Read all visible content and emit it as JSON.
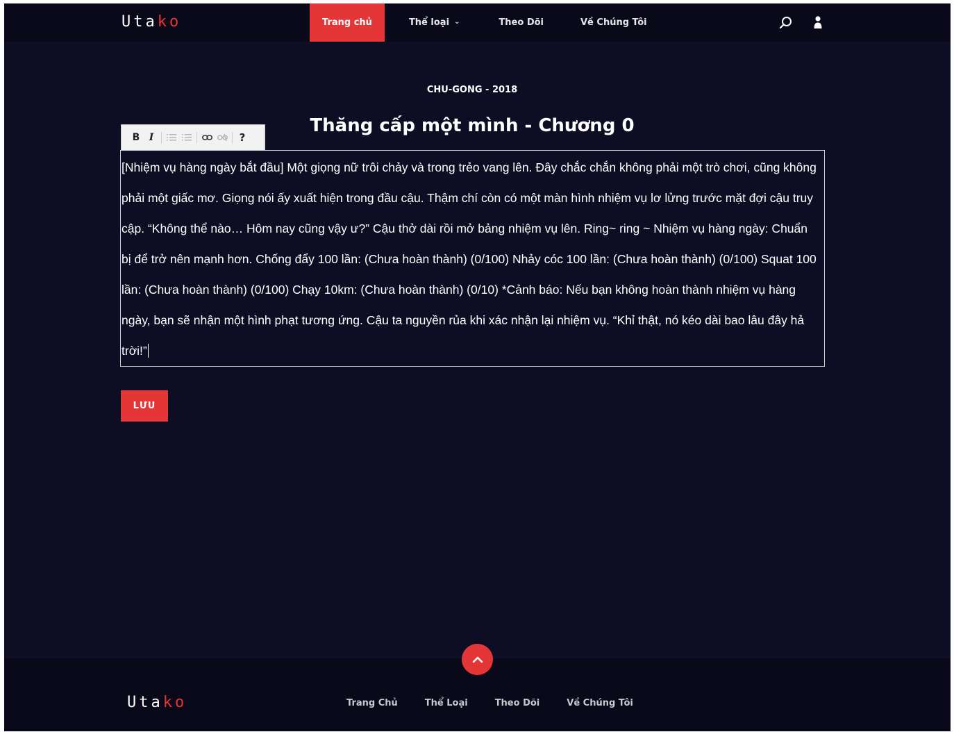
{
  "header": {
    "logo_main": "Uta",
    "logo_accent": "ko",
    "nav": [
      {
        "label": "Trang chủ"
      },
      {
        "label": "Thể loại"
      },
      {
        "label": "Theo Dõi"
      },
      {
        "label": "Về Chúng Tôi"
      }
    ],
    "dropdown_glyph": "⌄",
    "icons": {
      "search": "search-icon",
      "user": "user-icon"
    }
  },
  "content": {
    "eyebrow": "CHU-GONG - 2018",
    "title": "Thăng cấp một mình - Chương 0",
    "toolbar": {
      "bold": "B",
      "italic": "I",
      "help": "?"
    },
    "editor_text": "[Nhiệm vụ hàng ngày bắt đầu] Một giọng nữ trôi chảy và trong trẻo vang lên. Đây chắc chắn không phải một trò chơi, cũng không phải một giấc mơ. Giọng nói ấy xuất hiện trong đầu cậu. Thậm chí còn có một màn hình nhiệm vụ lơ lửng trước mặt đợi cậu truy cập. “Không thể nào… Hôm nay cũng vậy ư?” Cậu thở dài rồi mở bảng nhiệm vụ lên. Ring~ ring ~ Nhiệm vụ hàng ngày: Chuẩn bị để trở nên mạnh hơn. Chống đẩy 100 lần: (Chưa hoàn thành) (0/100) Nhảy cóc 100 lần: (Chưa hoàn thành) (0/100) Squat 100 lần: (Chưa hoàn thành) (0/100) Chạy 10km: (Chưa hoàn thành) (0/10) *Cảnh báo: Nếu bạn không hoàn thành nhiệm vụ hàng ngày, bạn sẽ nhận một hình phạt tương ứng. Cậu ta nguyền rủa khi xác nhận lại nhiệm vụ. “Khỉ thật, nó kéo dài bao lâu đây hả trời!”",
    "save_label": "LƯU"
  },
  "footer": {
    "logo_main": "Uta",
    "logo_accent": "ko",
    "links": [
      {
        "label": "Trang Chủ"
      },
      {
        "label": "Thể Loại"
      },
      {
        "label": "Theo Dõi"
      },
      {
        "label": "Về Chúng Tôi"
      }
    ]
  },
  "colors": {
    "background": "#0d0d24",
    "header": "#09091a",
    "accent": "#e53637"
  }
}
